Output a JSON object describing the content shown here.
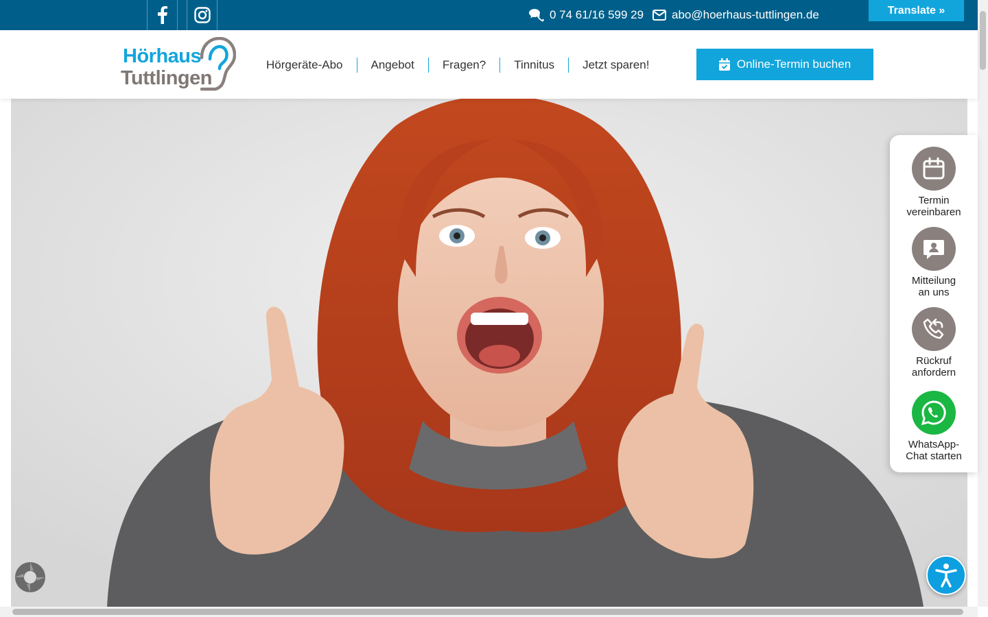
{
  "topbar": {
    "social": [
      {
        "name": "facebook-icon"
      },
      {
        "name": "instagram-icon"
      }
    ],
    "phone": "0 74 61/16 599 29",
    "email": "abo@hoerhaus-tuttlingen.de",
    "translate": "Translate »"
  },
  "header": {
    "logo_line1": "Hörhaus",
    "logo_line2": "Tuttlingen",
    "nav": [
      "Hörgeräte-Abo",
      "Angebot",
      "Fragen?",
      "Tinnitus",
      "Jetzt sparen!"
    ],
    "cta": "Online-Termin buchen"
  },
  "widget": {
    "items": [
      {
        "icon": "calendar-icon",
        "line1": "Termin",
        "line2": "vereinbaren"
      },
      {
        "icon": "message-icon",
        "line1": "Mitteilung",
        "line2": "an uns"
      },
      {
        "icon": "callback-phone-icon",
        "line1": "Rückruf",
        "line2": "anfordern"
      },
      {
        "icon": "whatsapp-icon",
        "line1": "WhatsApp-",
        "line2": "Chat starten"
      }
    ]
  },
  "colors": {
    "topbar": "#005f8a",
    "accent": "#12a5dc",
    "widget_icon": "#8a807d",
    "whatsapp": "#1ab743"
  }
}
